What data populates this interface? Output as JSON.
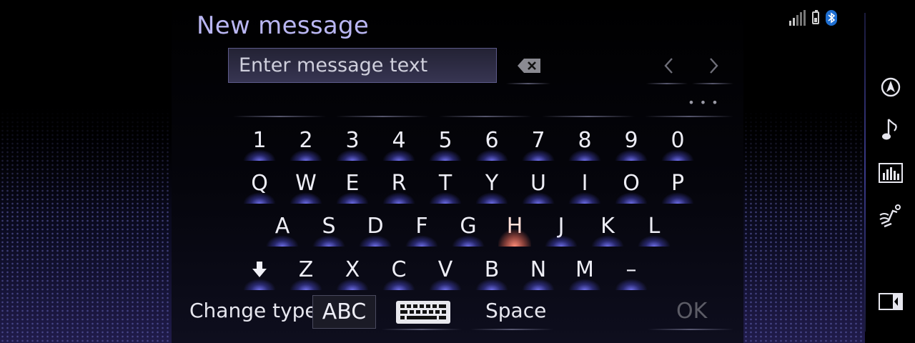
{
  "header": {
    "title": "New message"
  },
  "message_input": {
    "placeholder": "Enter message text",
    "value": ""
  },
  "status_icons": [
    "signal-icon",
    "battery-icon",
    "bluetooth-icon"
  ],
  "toolbar": {
    "backspace_icon": "backspace-icon",
    "left_icon": "chevron-left-icon",
    "right_icon": "chevron-right-icon",
    "more_label": "• • •"
  },
  "keyboard": {
    "row_numbers": [
      "1",
      "2",
      "3",
      "4",
      "5",
      "6",
      "7",
      "8",
      "9",
      "0"
    ],
    "row_q": [
      "Q",
      "W",
      "E",
      "R",
      "T",
      "Y",
      "U",
      "I",
      "O",
      "P"
    ],
    "row_a": [
      "A",
      "S",
      "D",
      "F",
      "G",
      "H",
      "J",
      "K",
      "L"
    ],
    "row_z": [
      "Z",
      "X",
      "C",
      "V",
      "B",
      "N",
      "M",
      "–"
    ],
    "shift_icon": "shift-down-arrow-icon",
    "active_key": "H"
  },
  "bottom_bar": {
    "change_type_label": "Change type",
    "abc_label": "ABC",
    "keyboard_icon": "keyboard-icon",
    "space_label": "Space",
    "ok_label": "OK"
  },
  "rail_icons": [
    "navigation-icon",
    "music-note-icon",
    "equalizer-icon",
    "climate-seat-icon",
    "split-screen-icon"
  ],
  "colors": {
    "title": "#b9b6f2",
    "key_glow": "#7878ff",
    "active_glow": "#ff8c78",
    "bluetooth": "#1f6fd1"
  }
}
